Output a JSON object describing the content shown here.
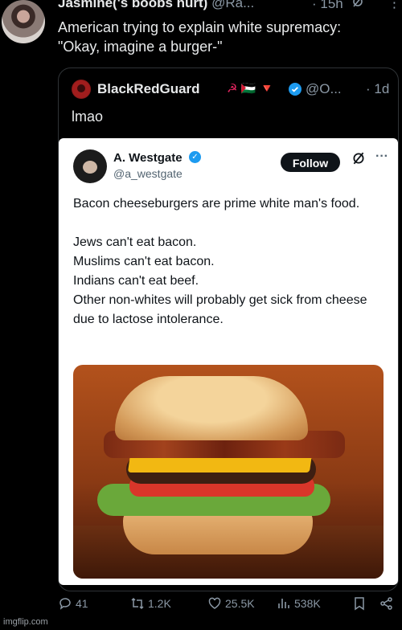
{
  "top_tweet": {
    "display_name": "Jasmine('s boobs hurt)",
    "handle": "@Ra...",
    "time": "· 15h",
    "text": "American trying to explain white supremacy:\n\"Okay, imagine a burger-\""
  },
  "quote_tweet": {
    "display_name": "BlackRedGuard",
    "emojis": "☭ 🇵🇸 🔻",
    "handle": "@O...",
    "time": "· 1d",
    "text": "lmao"
  },
  "embedded_tweet": {
    "display_name": "A. Westgate",
    "handle": "@a_westgate",
    "follow_label": "Follow",
    "more": "···",
    "body_first": "Bacon cheeseburgers are prime white man's food.",
    "body_lines": [
      "Jews can't eat bacon.",
      "Muslims can't eat bacon.",
      "Indians can't eat beef.",
      "Other non-whites will probably get sick from cheese due to lactose intolerance."
    ]
  },
  "actions": {
    "replies": "41",
    "reposts": "1.2K",
    "likes": "25.5K",
    "views": "538K"
  },
  "watermark": "imgflip.com",
  "colors": {
    "background": "#000000",
    "text": "#e7e9ea",
    "muted": "#8b98a5",
    "verified": "#1d9bf0"
  }
}
